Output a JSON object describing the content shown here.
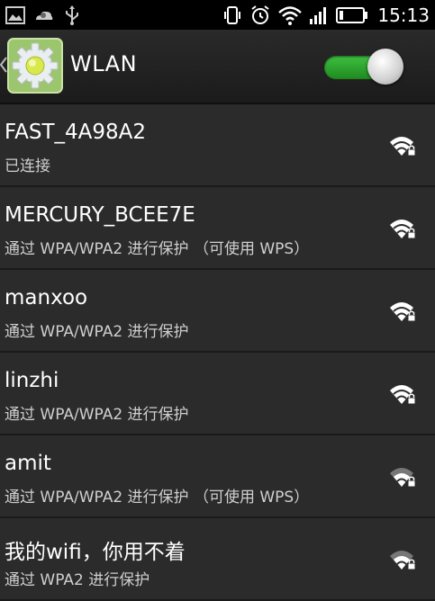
{
  "statusbar": {
    "time": "15:13",
    "left_icons": [
      "image-icon",
      "weather-icon",
      "usb-icon"
    ],
    "right_icons": [
      "vibrate-icon",
      "alarm-icon",
      "wifi-status-icon",
      "signal-icon",
      "battery-icon"
    ]
  },
  "header": {
    "title": "WLAN",
    "toggle_on": true,
    "accent": "#2fa82f"
  },
  "networks": [
    {
      "ssid": "FAST_4A98A2",
      "status": "已连接",
      "signal": "strong"
    },
    {
      "ssid": "MERCURY_BCEE7E",
      "status": "通过 WPA/WPA2 进行保护 （可使用 WPS）",
      "signal": "strong"
    },
    {
      "ssid": "manxoo",
      "status": "通过 WPA/WPA2 进行保护",
      "signal": "strong"
    },
    {
      "ssid": "linzhi",
      "status": "通过 WPA/WPA2 进行保护",
      "signal": "strong"
    },
    {
      "ssid": "amit",
      "status": "通过 WPA/WPA2 进行保护 （可使用 WPS）",
      "signal": "medium"
    },
    {
      "ssid": "我的wifi，你用不着",
      "status": "通过 WPA2 进行保护",
      "signal": "medium"
    }
  ]
}
